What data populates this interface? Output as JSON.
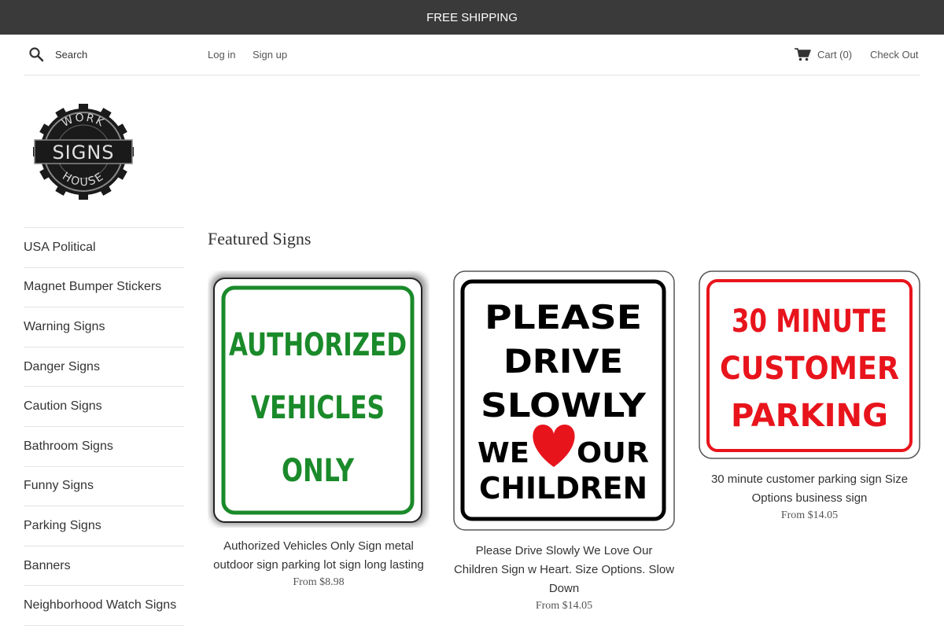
{
  "announcement": "FREE SHIPPING",
  "header": {
    "search_placeholder": "Search",
    "search_label": "Search",
    "login": "Log in",
    "signup": "Sign up",
    "cart_label": "Cart (0)",
    "checkout": "Check Out"
  },
  "logo": {
    "top_text": "WORK",
    "main_text": "SIGNS",
    "bottom_text": "HOUSE"
  },
  "sidebar": {
    "items": [
      {
        "label": "USA Political"
      },
      {
        "label": "Magnet Bumper Stickers"
      },
      {
        "label": "Warning Signs"
      },
      {
        "label": "Danger Signs"
      },
      {
        "label": "Caution Signs"
      },
      {
        "label": "Bathroom Signs"
      },
      {
        "label": "Funny Signs"
      },
      {
        "label": "Parking Signs"
      },
      {
        "label": "Banners"
      },
      {
        "label": "Neighborhood Watch Signs"
      }
    ]
  },
  "main": {
    "title": "Featured Signs",
    "products": [
      {
        "name": "Authorized Vehicles Only Sign metal outdoor sign parking lot sign long lasting",
        "price": "From $8.98",
        "sign_lines": [
          "AUTHORIZED",
          "VEHICLES",
          "ONLY"
        ],
        "sign_color": "#1a8a2a"
      },
      {
        "name": "Please Drive Slowly We Love Our Children Sign w Heart. Size Options. Slow Down",
        "price": "From $14.05",
        "sign_lines": [
          "PLEASE",
          "DRIVE",
          "SLOWLY",
          "WE",
          "OUR",
          "CHILDREN"
        ],
        "sign_color": "#000000",
        "heart_color": "#e8141c"
      },
      {
        "name": "30 minute customer parking sign Size Options business sign",
        "price": "From $14.05",
        "sign_lines": [
          "30 MINUTE",
          "CUSTOMER",
          "PARKING"
        ],
        "sign_color": "#e8141c"
      }
    ]
  }
}
